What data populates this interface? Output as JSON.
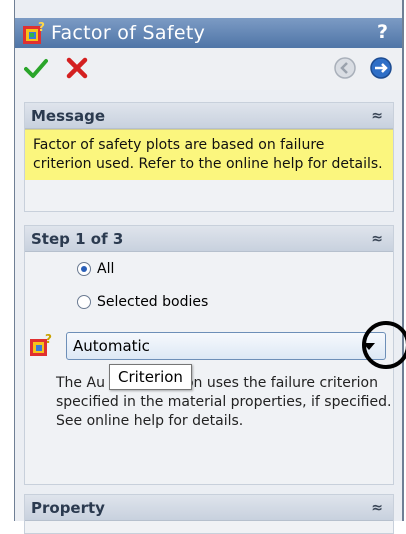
{
  "window": {
    "title": "Factor of Safety",
    "help": "?"
  },
  "toolbar": {
    "ok_icon": "checkmark-icon",
    "cancel_icon": "x-icon",
    "back_icon": "back-arrow-icon",
    "next_icon": "next-arrow-icon"
  },
  "message": {
    "header": "Message",
    "collapse_glyph": "≈",
    "text": "Factor of safety plots are based on failure criterion used. Refer to the online help for details."
  },
  "step": {
    "header": "Step 1 of 3",
    "collapse_glyph": "≈",
    "radio_all": "All",
    "radio_selected": "Selected bodies",
    "selected_radio": "All",
    "criterion_value": "Automatic",
    "tooltip": "Criterion",
    "desc_line1_a": "The Au",
    "desc_line1_b": "on uses the failure criterion",
    "desc_rest": "specified in the material properties, if specified. See online help for details."
  },
  "property": {
    "header": "Property",
    "expand_glyph": "≈"
  },
  "colors": {
    "title_bar": "#4f75a7",
    "message_bg": "#fbf67e",
    "ok": "#2aa52a",
    "cancel": "#d42020"
  }
}
